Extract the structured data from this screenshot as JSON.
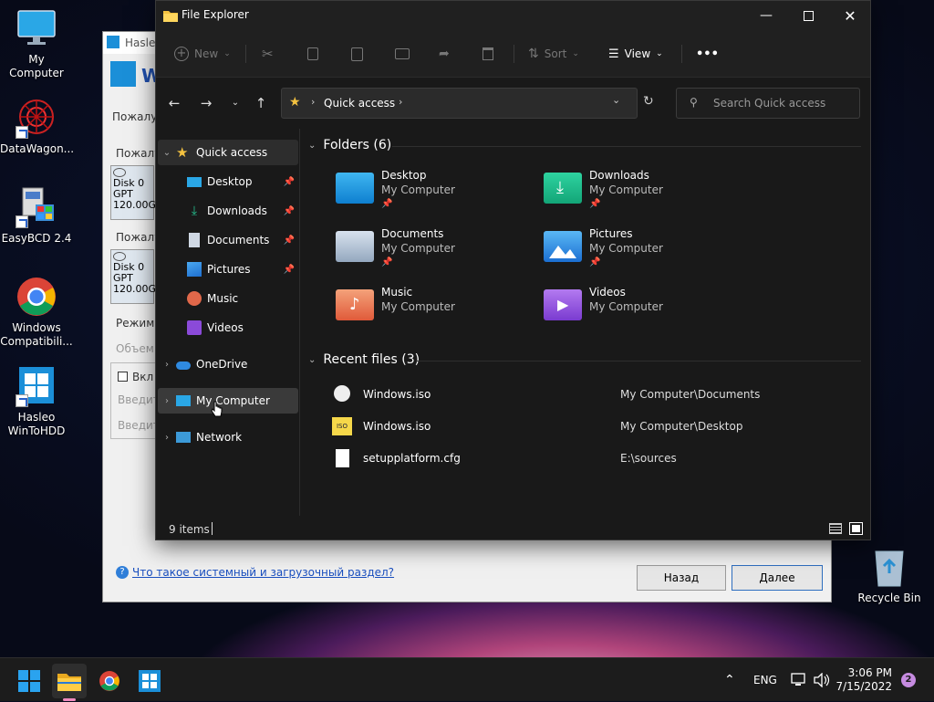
{
  "desktop": {
    "icons": [
      {
        "label": "My Computer",
        "icon": "monitor-icon"
      },
      {
        "label": "DataWagon...",
        "icon": "datawagon-icon"
      },
      {
        "label": "EasyBCD 2.4",
        "icon": "easybcd-icon"
      },
      {
        "label": "Windows Compatibili...",
        "label_line1": "Windows",
        "label_line2": "Compatibili...",
        "icon": "chrome-icon"
      },
      {
        "label": "Hasleo WinToHDD",
        "label_line1": "Hasleo",
        "label_line2": "WinToHDD",
        "icon": "hasleo-icon"
      },
      {
        "label": "Recycle Bin",
        "icon": "recycle-bin-icon"
      }
    ]
  },
  "back_window": {
    "title": "Hasle",
    "heading": "W",
    "line1": "Пожалу",
    "line2": "Пожалу",
    "disk1": {
      "l1": "Disk 0",
      "l2": "GPT",
      "l3": "120.00G"
    },
    "line3": "Пожалу",
    "disk2": {
      "l1": "Disk 0",
      "l2": "GPT",
      "l3": "120.00G"
    },
    "mode": "Режим у",
    "volume": "Объем",
    "checkbox": "Вкл",
    "input1": "Введите",
    "input2": "Введите",
    "help_link": "Что такое  системный и загрузочный раздел?",
    "back_button": "Назад",
    "next_button": "Далее"
  },
  "explorer": {
    "title": "File Explorer",
    "toolbar": {
      "new": "New",
      "sort": "Sort",
      "view": "View",
      "more": "•••"
    },
    "address": {
      "location": "Quick access",
      "search_placeholder": "Search Quick access"
    },
    "nav": {
      "quick_access": "Quick access",
      "desktop": "Desktop",
      "downloads": "Downloads",
      "documents": "Documents",
      "pictures": "Pictures",
      "music": "Music",
      "videos": "Videos",
      "onedrive": "OneDrive",
      "my_computer": "My Computer",
      "network": "Network"
    },
    "folders_header": "Folders (6)",
    "folders": [
      {
        "name": "Desktop",
        "location": "My Computer",
        "pinned": true
      },
      {
        "name": "Downloads",
        "location": "My Computer",
        "pinned": true
      },
      {
        "name": "Documents",
        "location": "My Computer",
        "pinned": true
      },
      {
        "name": "Pictures",
        "location": "My Computer",
        "pinned": true
      },
      {
        "name": "Music",
        "location": "My Computer",
        "pinned": false
      },
      {
        "name": "Videos",
        "location": "My Computer",
        "pinned": false
      }
    ],
    "recent_header": "Recent files (3)",
    "recent": [
      {
        "name": "Windows.iso",
        "location": "My Computer\\Documents"
      },
      {
        "name": "Windows.iso",
        "location": "My Computer\\Desktop"
      },
      {
        "name": "setupplatform.cfg",
        "location": "E:\\sources"
      }
    ],
    "status": {
      "items": "9 items"
    }
  },
  "taskbar": {
    "lang": "ENG",
    "time": "3:06 PM",
    "date": "7/15/2022",
    "notifications": "2"
  },
  "colors": {
    "accent": "#0078d4",
    "explorer_bg": "#191919",
    "taskbar_bg": "#1c1c1c"
  }
}
